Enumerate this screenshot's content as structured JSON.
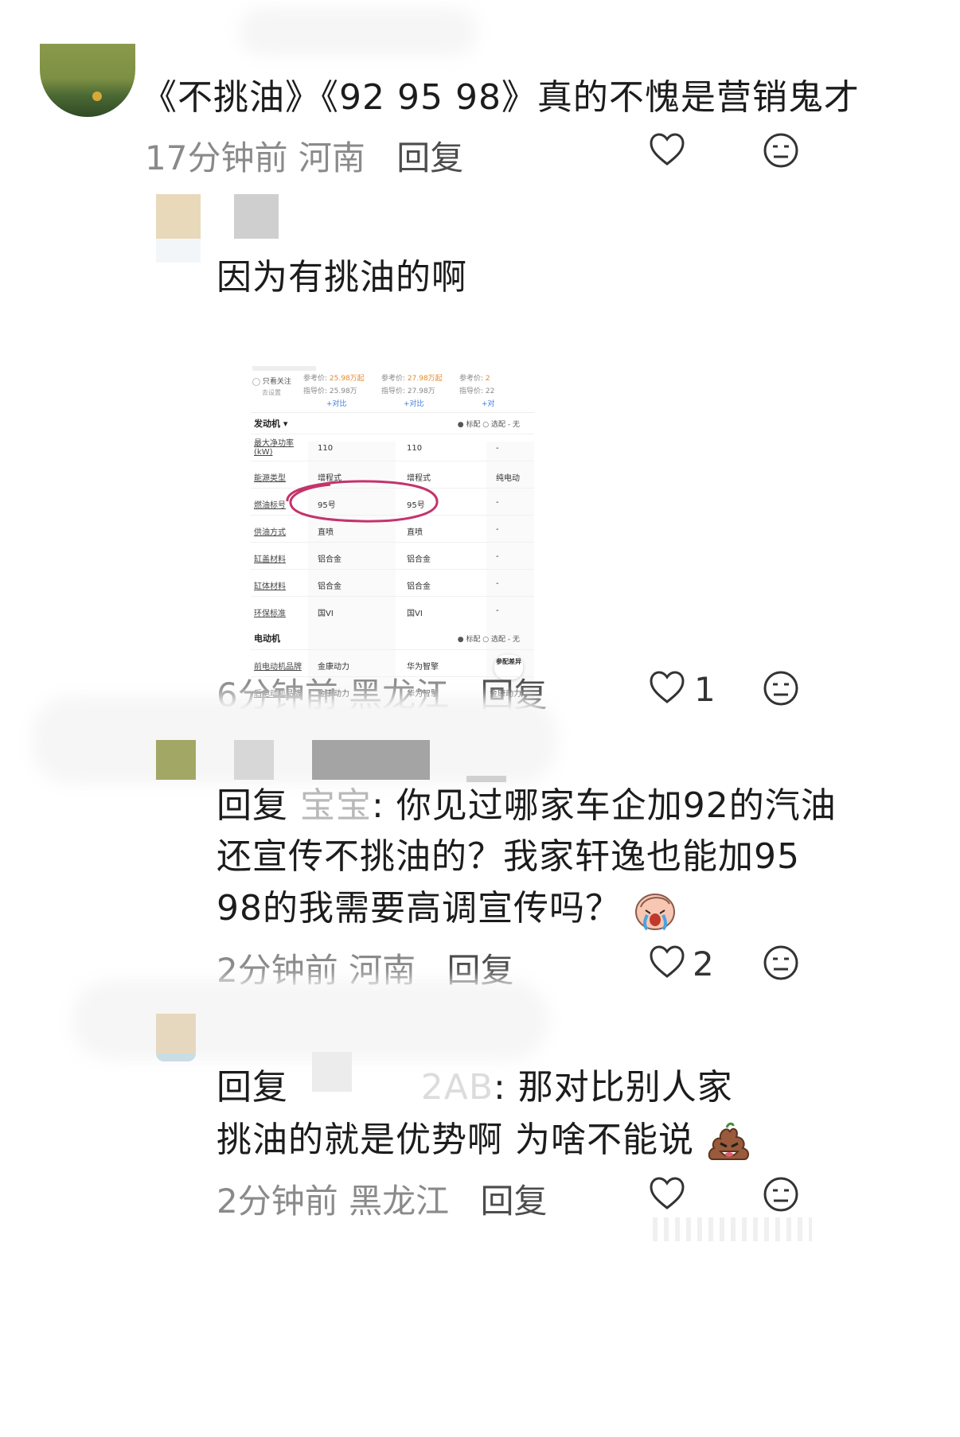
{
  "comments": [
    {
      "text": "《不挑油》《92 95 98》真的不愧是营销鬼才",
      "time": "17分钟前",
      "location": "河南",
      "reply_label": "回复",
      "likes": ""
    },
    {
      "text": "因为有挑油的啊",
      "time": "6分钟前",
      "location": "黑龙江",
      "reply_label": "回复",
      "likes": "1"
    },
    {
      "prefix": "回复",
      "mention": "宝宝",
      "line1_rest": ": 你见过哪家车企加92的汽油",
      "line2": "还宣传不挑油的？我家轩逸也能加95",
      "line3": "98的我需要高调宣传吗？",
      "time": "2分钟前",
      "location": "河南",
      "reply_label": "回复",
      "likes": "2"
    },
    {
      "prefix": "回复",
      "mention_tail": "2AB",
      "line1_rest": ": 那对比别人家",
      "line2": "挑油的就是优势啊 为啥不能说",
      "time": "2分钟前",
      "location": "黑龙江",
      "reply_label": "回复",
      "likes": ""
    }
  ],
  "screenshot": {
    "top_option": "只看关注",
    "top_option_sub": "去设置",
    "prices": [
      {
        "ref_label": "参考价:",
        "ref": "25.98万起",
        "guide_label": "指导价:",
        "guide": "25.98万",
        "compare": "+对比"
      },
      {
        "ref_label": "参考价:",
        "ref": "27.98万起",
        "guide_label": "指导价:",
        "guide": "27.98万",
        "compare": "+对比"
      },
      {
        "ref_label": "参考价:",
        "ref": "2",
        "guide_label": "指导价:",
        "guide": "22",
        "compare": "+对"
      }
    ],
    "section_engine": "发动机",
    "section_motor": "电动机",
    "legend": "● 标配  ○ 选配  - 无",
    "rows": [
      {
        "label": "最大净功率(kW)",
        "c1": "110",
        "c2": "110",
        "c3": "-"
      },
      {
        "label": "能源类型",
        "c1": "增程式",
        "c2": "增程式",
        "c3": "纯电动"
      },
      {
        "label": "燃油标号",
        "c1": "95号",
        "c2": "95号",
        "c3": "-"
      },
      {
        "label": "供油方式",
        "c1": "直喷",
        "c2": "直喷",
        "c3": "-"
      },
      {
        "label": "缸盖材料",
        "c1": "铝合金",
        "c2": "铝合金",
        "c3": "-"
      },
      {
        "label": "缸体材料",
        "c1": "铝合金",
        "c2": "铝合金",
        "c3": "-"
      },
      {
        "label": "环保标准",
        "c1": "国VI",
        "c2": "国VI",
        "c3": "-"
      }
    ],
    "motor_rows": [
      {
        "label": "前电动机品牌",
        "c1": "金康动力",
        "c2": "华为智擎",
        "c3": "参配差异"
      },
      {
        "label": "后电动机品牌",
        "c1": "金康动力",
        "c2": "华为智擎",
        "c3": "金康动力/"
      }
    ]
  },
  "colors": {
    "circle_mark": "#c4336b",
    "meta_gray": "#8a8a8a",
    "mention_gray": "#b9b9b9"
  },
  "icons": [
    "heart-icon",
    "meh-face-icon",
    "crying-face-emoji",
    "mischief-poop-emoji"
  ]
}
